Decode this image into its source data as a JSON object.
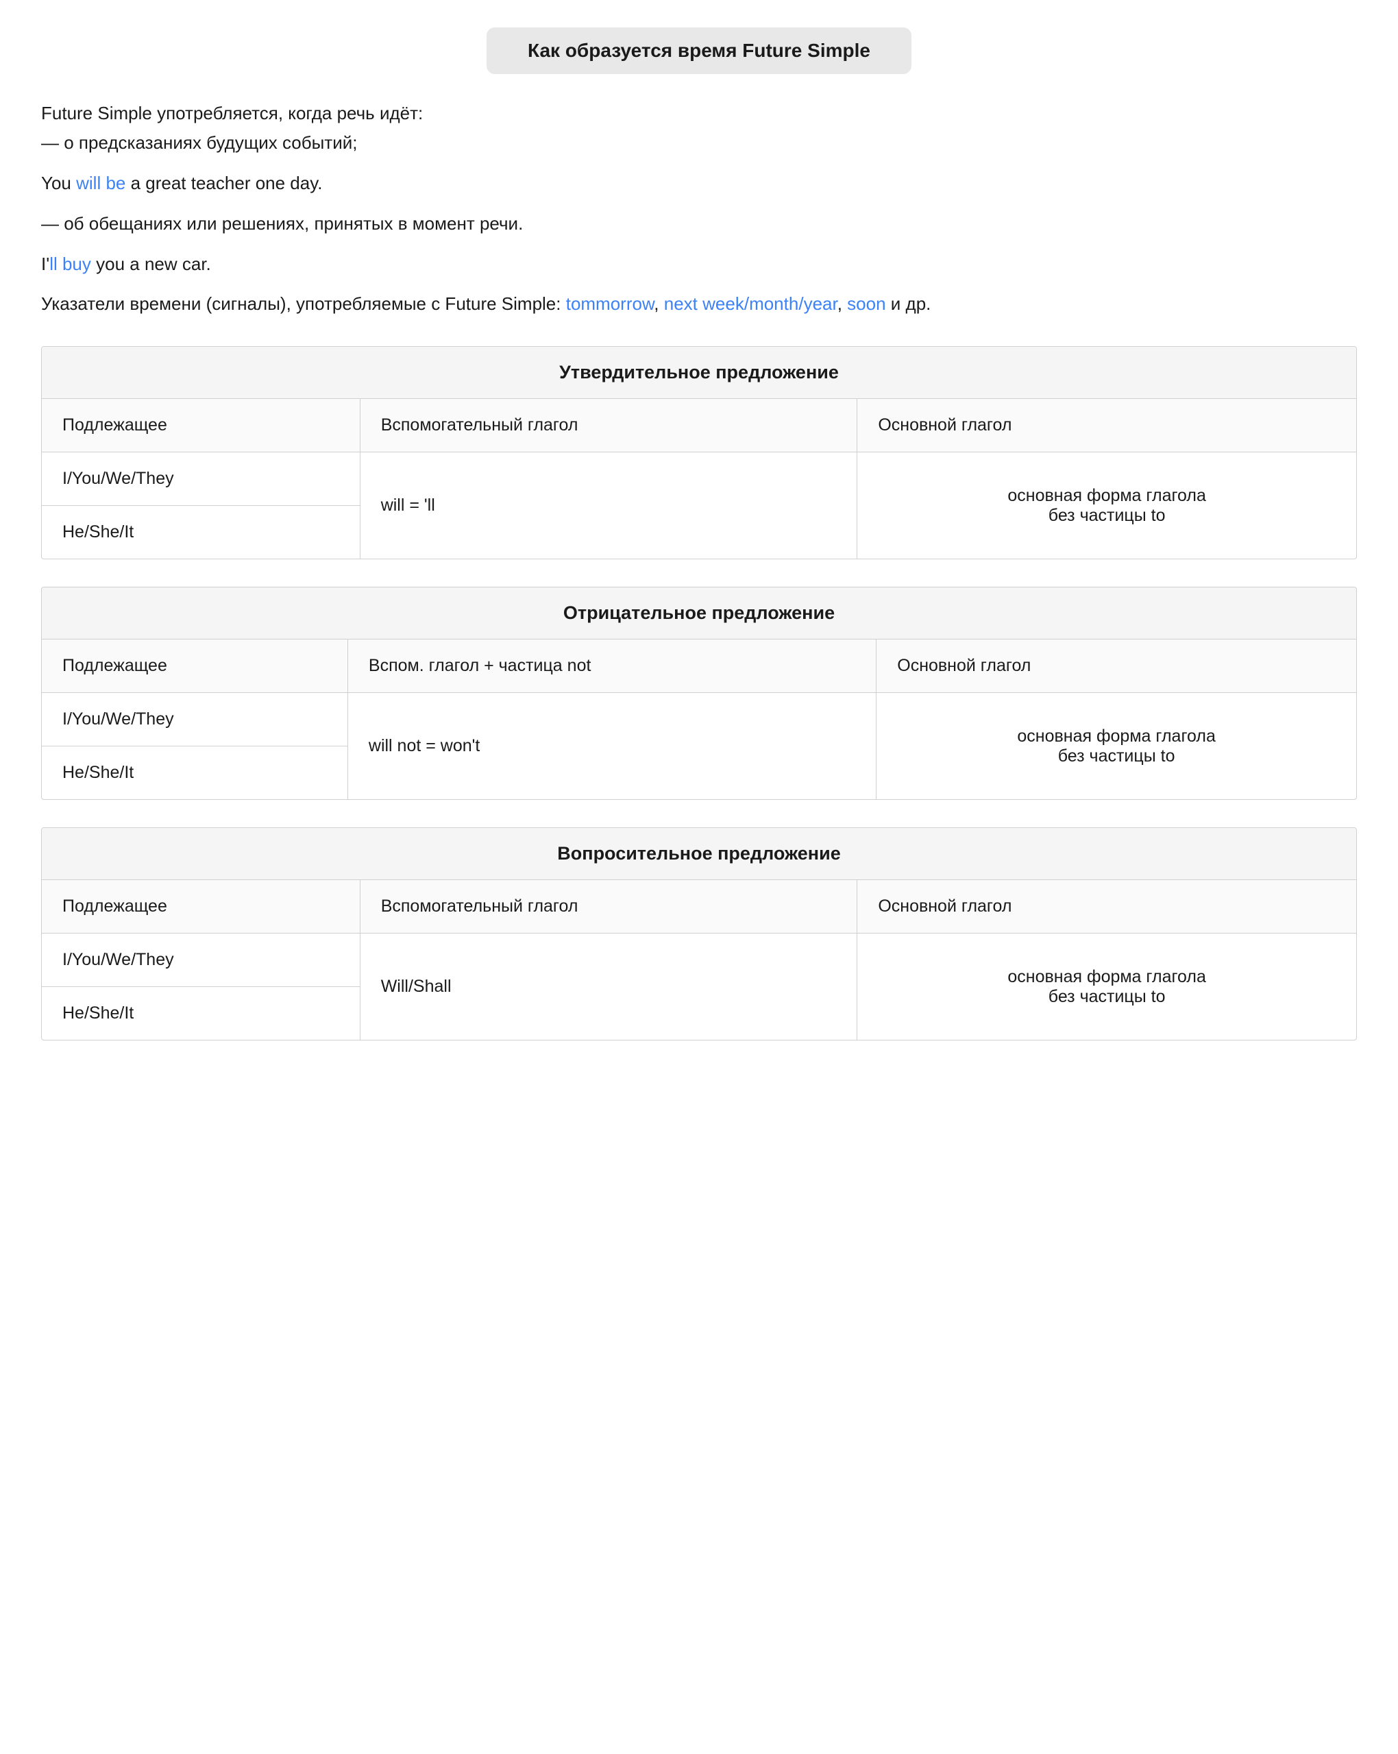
{
  "page": {
    "main_title": "Как образуется время Future Simple",
    "intro": {
      "line1": "Future Simple употребляется, когда речь идёт:",
      "line2": "— о предсказаниях будущих событий;",
      "line3_pre": "You ",
      "line3_highlight": "will be",
      "line3_post": " a great teacher one day.",
      "line4": "— об обещаниях или решениях, принятых в момент речи.",
      "line5_pre": "I'",
      "line5_highlight": "ll buy",
      "line5_post": " you a new car.",
      "line6_pre": "Указатели времени (сигналы), употребляемые с Future Simple: ",
      "line6_h1": "tommorrow",
      "line6_mid1": ", ",
      "line6_h2": "next week",
      "line6_sep1": "/",
      "line6_h3": "month",
      "line6_sep2": "/",
      "line6_h4": "year",
      "line6_mid2": ", ",
      "line6_h5": "soon",
      "line6_end": " и др."
    },
    "affirmative": {
      "header": "Утвердительное предложение",
      "col1": "Подлежащее",
      "col2": "Вспомогательный глагол",
      "col3": "Основной глагол",
      "subject_top": "I/You/We/They",
      "subject_bottom": "He/She/It",
      "aux_verb": "will = 'll",
      "main_verb_line1": "основная форма глагола",
      "main_verb_line2": "без частицы to"
    },
    "negative": {
      "header": "Отрицательное предложение",
      "col1": "Подлежащее",
      "col2": "Всп ом. глагол + частица not",
      "col3": "Основной глагол",
      "subject_top": "I/You/We/They",
      "subject_bottom": "He/She/It",
      "aux_verb": "will not = won't",
      "main_verb_line1": "основная форма глагола",
      "main_verb_line2": "без частицы to"
    },
    "question": {
      "header": "Вопросительное предложение",
      "col1": "Подлежащее",
      "col2": "Вспомогательный глагол",
      "col3": "Основной глагол",
      "subject_top": "I/You/We/They",
      "subject_bottom": "He/She/It",
      "aux_verb": "Will/Shall",
      "main_verb_line1": "основная форма глагола",
      "main_verb_line2": "без частицы to"
    }
  }
}
